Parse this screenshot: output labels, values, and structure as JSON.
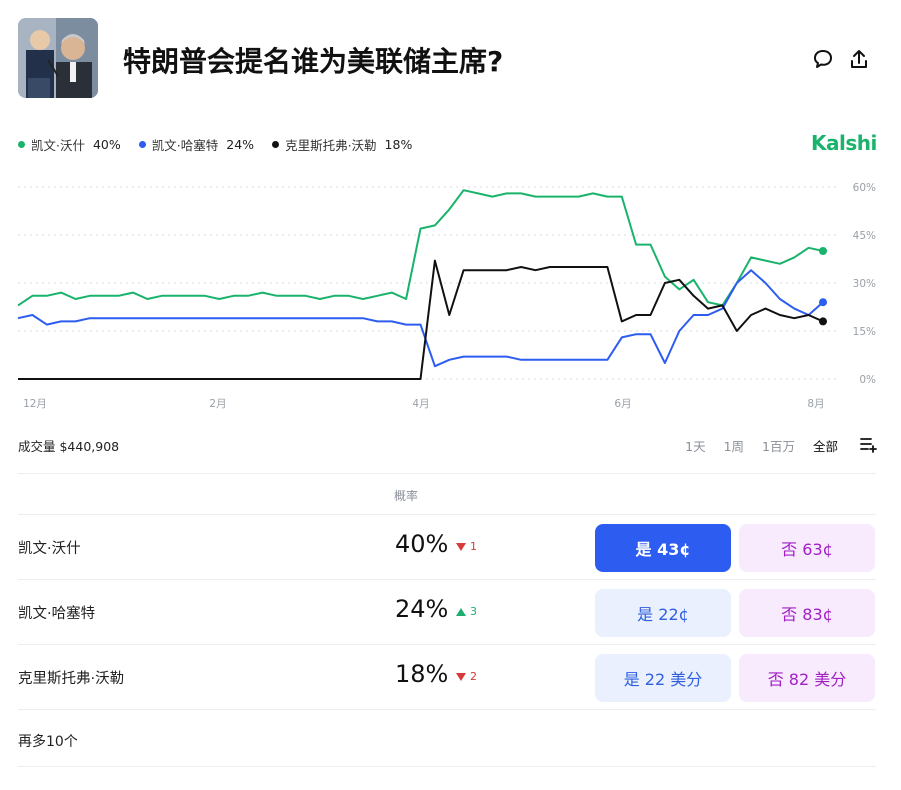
{
  "header": {
    "title": "特朗普会提名谁为美联储主席?",
    "avatar_icon": "portrait-photo",
    "comment_icon": "comment-icon",
    "share_icon": "share-icon"
  },
  "brand": "Kalshi",
  "legend": [
    {
      "name": "凯文·沃什",
      "pct": "40%",
      "color": "#19b36b"
    },
    {
      "name": "凯文·哈塞特",
      "pct": "24%",
      "color": "#2d5cf0"
    },
    {
      "name": "克里斯托弗·沃勒",
      "pct": "18%",
      "color": "#111111"
    }
  ],
  "chart_data": {
    "type": "line",
    "x_tick_labels": [
      "12月",
      "2月",
      "4月",
      "6月",
      "8月"
    ],
    "y_tick_labels": [
      "60%",
      "45%",
      "30%",
      "15%",
      "0%"
    ],
    "ylim": [
      0,
      60
    ],
    "x": [
      0,
      5,
      10,
      15,
      20,
      25,
      30,
      35,
      40,
      45,
      50,
      55,
      60,
      65,
      70,
      75,
      80,
      85,
      90,
      95,
      100,
      105,
      110,
      115,
      120,
      125,
      130,
      135,
      140,
      145,
      150,
      155,
      160,
      165,
      170,
      175,
      180,
      185,
      190,
      195,
      200,
      205,
      210,
      215,
      220,
      225,
      230,
      235,
      240,
      245,
      250,
      255,
      260,
      265,
      270,
      275,
      280
    ],
    "series": [
      {
        "name": "凯文·沃什",
        "color": "#19b36b",
        "values": [
          23,
          26,
          26,
          27,
          25,
          26,
          26,
          26,
          27,
          25,
          26,
          26,
          26,
          26,
          25,
          26,
          26,
          27,
          26,
          26,
          26,
          25,
          26,
          26,
          25,
          26,
          27,
          25,
          47,
          48,
          53,
          59,
          58,
          57,
          58,
          58,
          57,
          57,
          57,
          57,
          58,
          57,
          57,
          42,
          42,
          32,
          28,
          31,
          24,
          23,
          30,
          38,
          37,
          36,
          38,
          41,
          40
        ]
      },
      {
        "name": "凯文·哈塞特",
        "color": "#2d5cf0",
        "values": [
          19,
          20,
          17,
          18,
          18,
          19,
          19,
          19,
          19,
          19,
          19,
          19,
          19,
          19,
          19,
          19,
          19,
          19,
          19,
          19,
          19,
          19,
          19,
          19,
          19,
          18,
          18,
          17,
          17,
          4,
          6,
          7,
          7,
          7,
          7,
          6,
          6,
          6,
          6,
          6,
          6,
          6,
          13,
          14,
          14,
          5,
          15,
          20,
          20,
          22,
          30,
          34,
          30,
          25,
          22,
          20,
          24
        ]
      },
      {
        "name": "克里斯托弗·沃勒",
        "color": "#111111",
        "values": [
          0,
          0,
          0,
          0,
          0,
          0,
          0,
          0,
          0,
          0,
          0,
          0,
          0,
          0,
          0,
          0,
          0,
          0,
          0,
          0,
          0,
          0,
          0,
          0,
          0,
          0,
          0,
          0,
          0,
          37,
          20,
          34,
          34,
          34,
          34,
          35,
          34,
          35,
          35,
          35,
          35,
          35,
          18,
          20,
          20,
          30,
          31,
          26,
          22,
          23,
          15,
          20,
          22,
          20,
          19,
          20,
          18
        ]
      }
    ]
  },
  "volume": "成交量 $440,908",
  "ranges": [
    "1天",
    "1周",
    "1百万",
    "全部"
  ],
  "active_range": "全部",
  "prob_header": "概率",
  "rows": [
    {
      "name": "凯文·沃什",
      "pct": "40%",
      "direction": "down",
      "delta": "1",
      "yes": "是 43¢",
      "no": "否 63¢"
    },
    {
      "name": "凯文·哈塞特",
      "pct": "24%",
      "direction": "up",
      "delta": "3",
      "yes": "是 22¢",
      "no": "否 83¢"
    },
    {
      "name": "克里斯托弗·沃勒",
      "pct": "18%",
      "direction": "down",
      "delta": "2",
      "yes": "是 22 美分",
      "no": "否 82 美分"
    }
  ],
  "more": "再多10个"
}
